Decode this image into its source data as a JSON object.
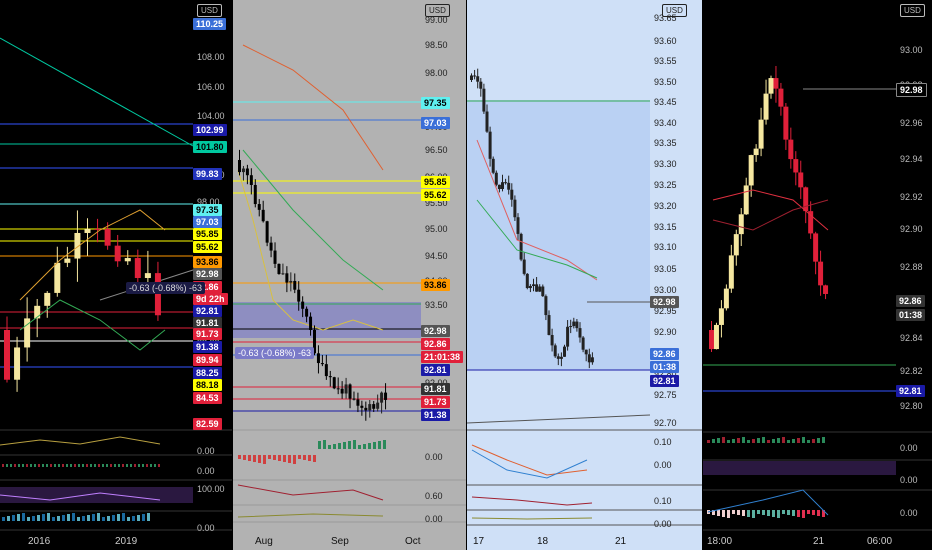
{
  "currency": "USD",
  "panels": [
    {
      "name": "weekly",
      "price_ticks": [
        "108.00",
        "106.00",
        "104.00",
        "102.00",
        "100.00",
        "98.00",
        "96.00",
        "94.00",
        "92.00",
        "90.00",
        "88.00",
        "86.00",
        "84.00"
      ],
      "tags": [
        {
          "text": "110.25",
          "bg": "#3a6fd8",
          "fg": "#fff"
        },
        {
          "text": "102.99",
          "bg": "#1a1aa6",
          "fg": "#fff"
        },
        {
          "text": "101.80",
          "bg": "#00c8a0",
          "fg": "#000"
        },
        {
          "text": "99.83",
          "bg": "#2233bb",
          "fg": "#fff"
        },
        {
          "text": "97.35",
          "bg": "#5ff0f0",
          "fg": "#000"
        },
        {
          "text": "97.03",
          "bg": "#3a6fd8",
          "fg": "#fff"
        },
        {
          "text": "95.85",
          "bg": "#ffff00",
          "fg": "#000"
        },
        {
          "text": "95.62",
          "bg": "#ffff00",
          "fg": "#000"
        },
        {
          "text": "93.86",
          "bg": "#ff9900",
          "fg": "#000"
        },
        {
          "text": "92.98",
          "bg": "#555",
          "fg": "#fff"
        },
        {
          "text": "92.86",
          "bg": "#e0203a",
          "fg": "#fff"
        },
        {
          "text": "9d 22h",
          "bg": "#e0203a",
          "fg": "#fff"
        },
        {
          "text": "92.81",
          "bg": "#1a1aa6",
          "fg": "#fff"
        },
        {
          "text": "91.81",
          "bg": "#333",
          "fg": "#fff"
        },
        {
          "text": "91.73",
          "bg": "#e0203a",
          "fg": "#fff"
        },
        {
          "text": "91.38",
          "bg": "#1a1aa6",
          "fg": "#fff"
        },
        {
          "text": "89.94",
          "bg": "#e0203a",
          "fg": "#fff"
        },
        {
          "text": "88.25",
          "bg": "#1a1aa6",
          "fg": "#fff"
        },
        {
          "text": "88.18",
          "bg": "#ffff00",
          "fg": "#000"
        },
        {
          "text": "84.53",
          "bg": "#e0203a",
          "fg": "#fff"
        },
        {
          "text": "82.59",
          "bg": "#e0203a",
          "fg": "#fff"
        }
      ],
      "measure": "-0.63 (-0.68%) -63",
      "ind_ticks": [
        "0.00",
        "0.00",
        "100.00",
        "0.00"
      ],
      "time_labels": [
        "2016",
        "2019"
      ]
    },
    {
      "name": "daily",
      "price_ticks": [
        "99.00",
        "98.50",
        "98.00",
        "97.50",
        "97.00",
        "96.50",
        "96.00",
        "95.50",
        "95.00",
        "94.50",
        "94.00",
        "93.50",
        "93.00",
        "92.50",
        "92.00"
      ],
      "tags": [
        {
          "text": "97.35",
          "bg": "#5ff0f0",
          "fg": "#000"
        },
        {
          "text": "97.03",
          "bg": "#3a6fd8",
          "fg": "#fff"
        },
        {
          "text": "95.85",
          "bg": "#ffff00",
          "fg": "#000"
        },
        {
          "text": "95.62",
          "bg": "#ffff00",
          "fg": "#000"
        },
        {
          "text": "93.86",
          "bg": "#ff9900",
          "fg": "#000"
        },
        {
          "text": "92.98",
          "bg": "#555",
          "fg": "#fff"
        },
        {
          "text": "92.86",
          "bg": "#e0203a",
          "fg": "#fff"
        },
        {
          "text": "21:01:38",
          "bg": "#e0203a",
          "fg": "#fff"
        },
        {
          "text": "92.81",
          "bg": "#1a1aa6",
          "fg": "#fff"
        },
        {
          "text": "91.81",
          "bg": "#333",
          "fg": "#fff"
        },
        {
          "text": "91.73",
          "bg": "#e0203a",
          "fg": "#fff"
        },
        {
          "text": "91.38",
          "bg": "#1a1aa6",
          "fg": "#fff"
        }
      ],
      "measure": "-0.63 (-0.68%) -63",
      "ind_ticks": [
        "0.00",
        "0.60",
        "0.00"
      ],
      "time_labels": [
        "Aug",
        "Sep",
        "Oct"
      ]
    },
    {
      "name": "hourly",
      "price_ticks": [
        "93.65",
        "93.60",
        "93.55",
        "93.50",
        "93.45",
        "93.40",
        "93.35",
        "93.30",
        "93.25",
        "93.20",
        "93.15",
        "93.10",
        "93.05",
        "93.00",
        "92.95",
        "92.90",
        "92.85",
        "92.80",
        "92.75",
        "92.70"
      ],
      "tags": [
        {
          "text": "92.98",
          "bg": "#555",
          "fg": "#fff"
        },
        {
          "text": "92.86",
          "bg": "#3a6fd8",
          "fg": "#fff"
        },
        {
          "text": "01:38",
          "bg": "#3a6fd8",
          "fg": "#fff"
        },
        {
          "text": "92.81",
          "bg": "#1a1aa6",
          "fg": "#fff"
        }
      ],
      "ind_ticks": [
        "0.10",
        "0.00",
        "0.10",
        "0.00"
      ],
      "time_labels": [
        "17",
        "18",
        "21"
      ]
    },
    {
      "name": "m15",
      "price_ticks": [
        "93.00",
        "92.98",
        "92.96",
        "92.94",
        "92.92",
        "92.90",
        "92.88",
        "92.86",
        "92.84",
        "92.82",
        "92.80"
      ],
      "tags": [
        {
          "text": "92.98",
          "bg": "#000",
          "fg": "#fff",
          "border": "#888"
        },
        {
          "text": "92.86",
          "bg": "#333",
          "fg": "#fff"
        },
        {
          "text": "01:38",
          "bg": "#333",
          "fg": "#fff"
        },
        {
          "text": "92.81",
          "bg": "#1a1aa6",
          "fg": "#fff"
        }
      ],
      "ind_ticks": [
        "0.00",
        "0.00",
        "0.00"
      ],
      "time_labels": [
        "18:00",
        "21",
        "06:00"
      ]
    }
  ],
  "colors": {
    "up": "#f5e7a0",
    "down": "#e0203a",
    "grid": "#222"
  }
}
